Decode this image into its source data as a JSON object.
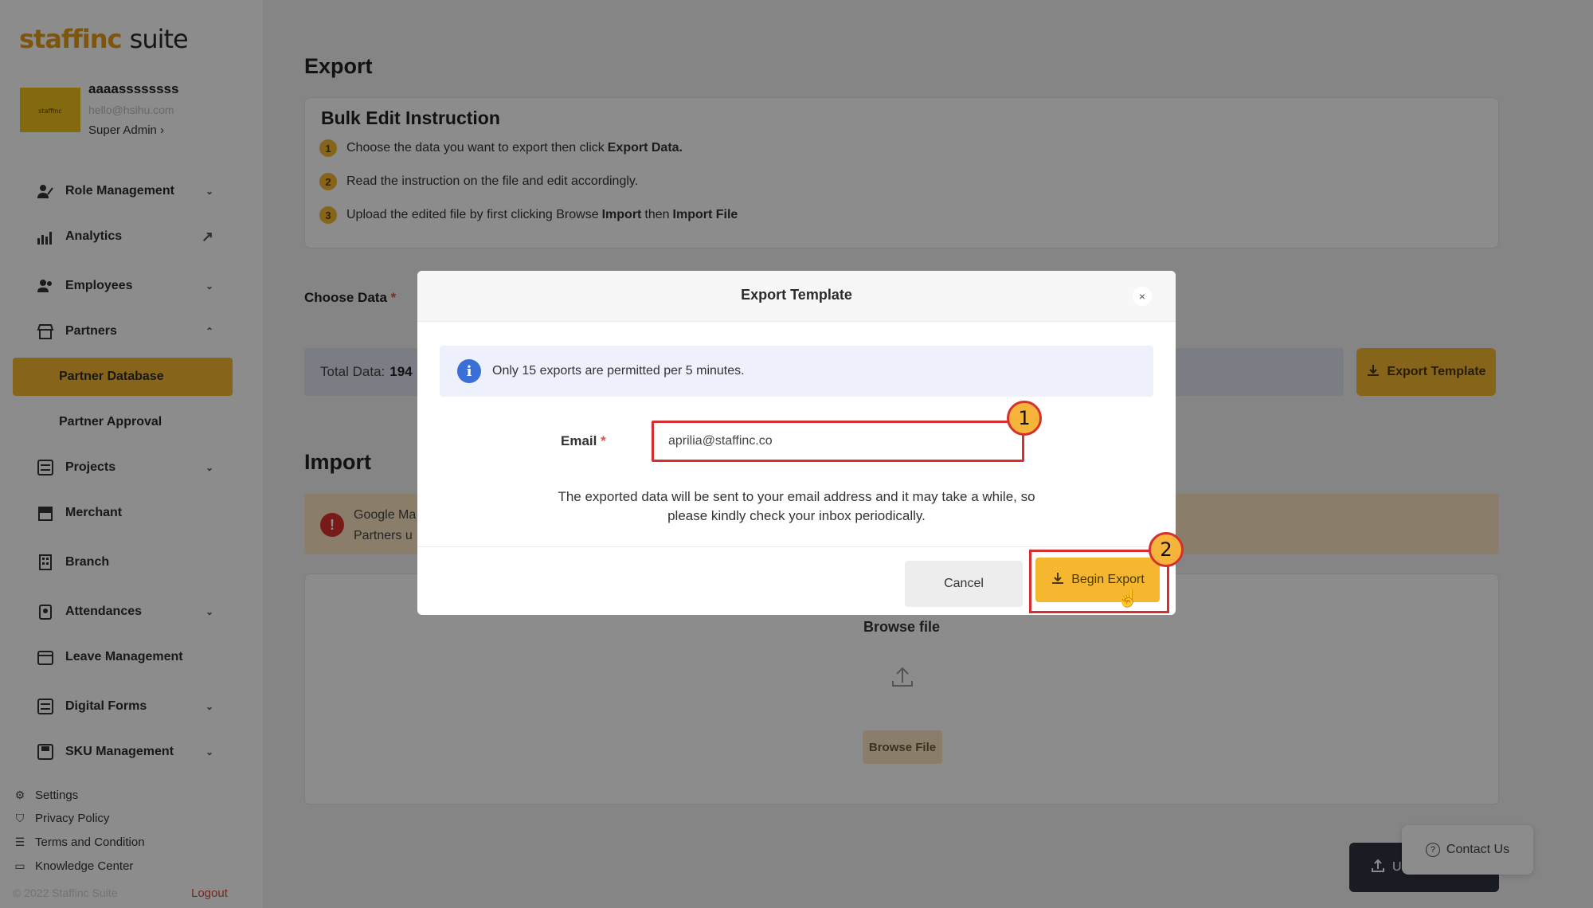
{
  "app": {
    "logo_brand": "staffinc",
    "logo_suite": "suite"
  },
  "profile": {
    "name": "aaaassssssss",
    "email": "hello@hsihu.com",
    "role": "Super Admin ›"
  },
  "sidebar": {
    "items": [
      {
        "label": "Role Management",
        "icon": "role-icon",
        "chev": "⌄"
      },
      {
        "label": "Analytics",
        "icon": "analytics-icon",
        "chev": "↗"
      },
      {
        "label": "Employees",
        "icon": "employees-icon",
        "chev": "⌄"
      },
      {
        "label": "Partners",
        "icon": "partners-icon",
        "chev": "⌃"
      },
      {
        "label": "Projects",
        "icon": "projects-icon",
        "chev": "⌄"
      },
      {
        "label": "Merchant",
        "icon": "merchant-icon",
        "chev": ""
      },
      {
        "label": "Branch",
        "icon": "branch-icon",
        "chev": ""
      },
      {
        "label": "Attendances",
        "icon": "attendances-icon",
        "chev": "⌄"
      },
      {
        "label": "Leave Management",
        "icon": "leave-icon",
        "chev": ""
      },
      {
        "label": "Digital Forms",
        "icon": "forms-icon",
        "chev": "⌄"
      },
      {
        "label": "SKU Management",
        "icon": "sku-icon",
        "chev": "⌄"
      }
    ],
    "sub_items": [
      {
        "label": "Partner Database"
      },
      {
        "label": "Partner Approval"
      }
    ],
    "footer": [
      {
        "label": "Settings",
        "icon": "gear-icon"
      },
      {
        "label": "Privacy Policy",
        "icon": "privacy-icon"
      },
      {
        "label": "Terms and Condition",
        "icon": "terms-icon"
      },
      {
        "label": "Knowledge Center",
        "icon": "book-icon"
      }
    ],
    "copyright": "© 2022 Staffinc Suite",
    "logout": "Logout"
  },
  "main": {
    "export_title": "Export",
    "instruction": {
      "title": "Bulk Edit Instruction",
      "steps": [
        {
          "num": "1",
          "pre": "Choose the data you want to export then click",
          "bold": "Export Data.",
          "mid": "",
          "bold2": ""
        },
        {
          "num": "2",
          "pre": "Read the instruction on the file and edit accordingly.",
          "bold": "",
          "mid": "",
          "bold2": ""
        },
        {
          "num": "3",
          "pre": "Upload the edited file by first clicking Browse",
          "bold": "Import",
          "mid": "then",
          "bold2": "Import File"
        }
      ]
    },
    "choose_data_label": "Choose Data",
    "required_mark": "*",
    "total_label": "Total Data:",
    "total_value": "194",
    "export_template_button": "Export Template",
    "import_title": "Import",
    "warning_line1": "Google Ma",
    "warning_line2": "Partners u",
    "browse_title": "Browse file",
    "browse_button": "Browse File",
    "upload_button": "U",
    "contact_button": "Contact Us"
  },
  "modal": {
    "title": "Export Template",
    "close": "×",
    "info": "Only 15 exports are permitted per 5 minutes.",
    "email_label": "Email",
    "required_mark": "*",
    "email_value": "aprilia@staffinc.co",
    "note_line1": "The exported data will be sent to your email address and it may take a while, so",
    "note_line2": "please kindly check your inbox periodically.",
    "cancel_button": "Cancel",
    "begin_button": "Begin Export"
  },
  "annotations": {
    "badge1": "1",
    "badge2": "2"
  },
  "colors": {
    "accent": "#f4b72f",
    "highlight_border": "#d62f2f",
    "info_blue": "#3a6fd8",
    "warning_red": "#d9302c"
  }
}
